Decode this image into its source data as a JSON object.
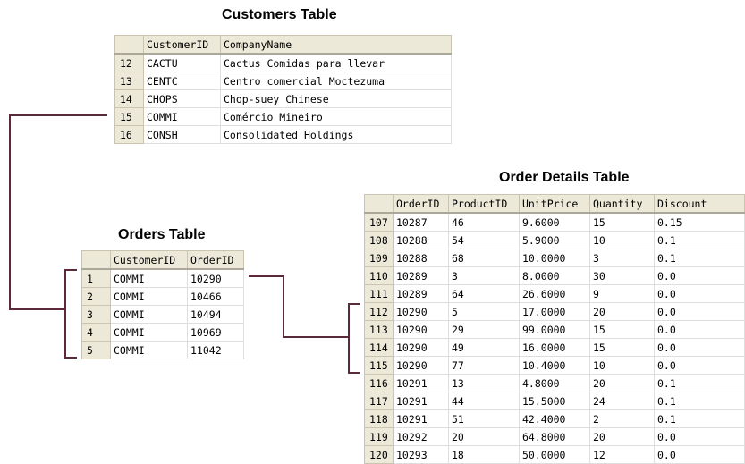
{
  "customers": {
    "title": "Customers Table",
    "headers": [
      "CustomerID",
      "CompanyName"
    ],
    "rows": [
      {
        "n": "12",
        "cells": [
          "CACTU",
          "Cactus Comidas para llevar"
        ]
      },
      {
        "n": "13",
        "cells": [
          "CENTC",
          "Centro comercial Moctezuma"
        ]
      },
      {
        "n": "14",
        "cells": [
          "CHOPS",
          "Chop-suey Chinese"
        ]
      },
      {
        "n": "15",
        "cells": [
          "COMMI",
          "Comércio Mineiro"
        ]
      },
      {
        "n": "16",
        "cells": [
          "CONSH",
          "Consolidated Holdings"
        ]
      }
    ]
  },
  "orders": {
    "title": "Orders Table",
    "headers": [
      "CustomerID",
      "OrderID"
    ],
    "rows": [
      {
        "n": "1",
        "cells": [
          "COMMI",
          "10290"
        ]
      },
      {
        "n": "2",
        "cells": [
          "COMMI",
          "10466"
        ]
      },
      {
        "n": "3",
        "cells": [
          "COMMI",
          "10494"
        ]
      },
      {
        "n": "4",
        "cells": [
          "COMMI",
          "10969"
        ]
      },
      {
        "n": "5",
        "cells": [
          "COMMI",
          "11042"
        ]
      }
    ]
  },
  "order_details": {
    "title": "Order Details Table",
    "headers": [
      "OrderID",
      "ProductID",
      "UnitPrice",
      "Quantity",
      "Discount"
    ],
    "rows": [
      {
        "n": "107",
        "cells": [
          "10287",
          "46",
          "9.6000",
          "15",
          "0.15"
        ]
      },
      {
        "n": "108",
        "cells": [
          "10288",
          "54",
          "5.9000",
          "10",
          "0.1"
        ]
      },
      {
        "n": "109",
        "cells": [
          "10288",
          "68",
          "10.0000",
          "3",
          "0.1"
        ]
      },
      {
        "n": "110",
        "cells": [
          "10289",
          "3",
          "8.0000",
          "30",
          "0.0"
        ]
      },
      {
        "n": "111",
        "cells": [
          "10289",
          "64",
          "26.6000",
          "9",
          "0.0"
        ]
      },
      {
        "n": "112",
        "cells": [
          "10290",
          "5",
          "17.0000",
          "20",
          "0.0"
        ]
      },
      {
        "n": "113",
        "cells": [
          "10290",
          "29",
          "99.0000",
          "15",
          "0.0"
        ]
      },
      {
        "n": "114",
        "cells": [
          "10290",
          "49",
          "16.0000",
          "15",
          "0.0"
        ]
      },
      {
        "n": "115",
        "cells": [
          "10290",
          "77",
          "10.4000",
          "10",
          "0.0"
        ]
      },
      {
        "n": "116",
        "cells": [
          "10291",
          "13",
          "4.8000",
          "20",
          "0.1"
        ]
      },
      {
        "n": "117",
        "cells": [
          "10291",
          "44",
          "15.5000",
          "24",
          "0.1"
        ]
      },
      {
        "n": "118",
        "cells": [
          "10291",
          "51",
          "42.4000",
          "2",
          "0.1"
        ]
      },
      {
        "n": "119",
        "cells": [
          "10292",
          "20",
          "64.8000",
          "20",
          "0.0"
        ]
      },
      {
        "n": "120",
        "cells": [
          "10293",
          "18",
          "50.0000",
          "12",
          "0.0"
        ]
      }
    ]
  },
  "connector_color": "#5a2a3a"
}
